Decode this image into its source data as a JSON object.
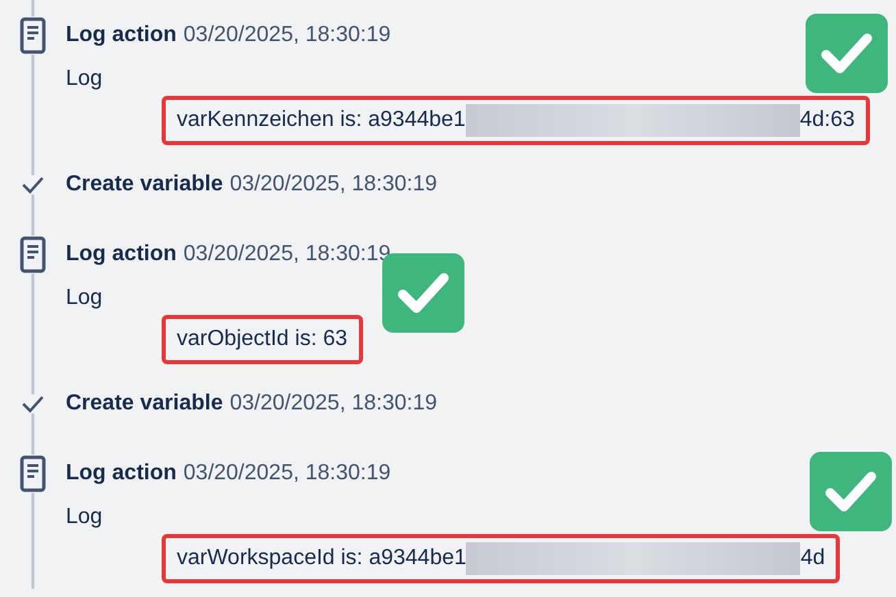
{
  "entries": [
    {
      "kind": "log",
      "title": "Log action",
      "time": "03/20/2025, 18:30:19",
      "label": "Log",
      "value_start": "varKennzeichen is: a9344be1",
      "redacted": true,
      "value_end": "4d:63",
      "check_badge": true
    },
    {
      "kind": "variable",
      "title": "Create variable",
      "time": "03/20/2025, 18:30:19"
    },
    {
      "kind": "log",
      "title": "Log action",
      "time": "03/20/2025, 18:30:19",
      "label": "Log",
      "value_start": "varObjectId is: 63",
      "redacted": false,
      "check_badge": true
    },
    {
      "kind": "variable",
      "title": "Create variable",
      "time": "03/20/2025, 18:30:19"
    },
    {
      "kind": "log",
      "title": "Log action",
      "time": "03/20/2025, 18:30:19",
      "label": "Log",
      "value_start": "varWorkspaceId is: a9344be1",
      "redacted": true,
      "value_end": "4d",
      "check_badge": true
    }
  ]
}
